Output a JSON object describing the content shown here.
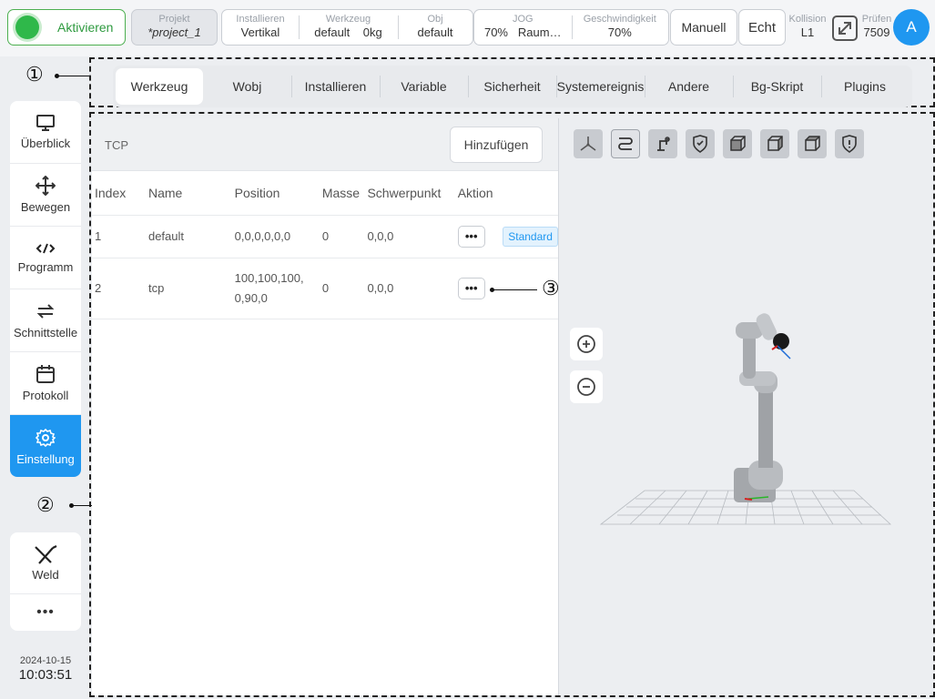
{
  "topbar": {
    "activate_label": "Aktivieren",
    "project": {
      "caption": "Projekt",
      "value": "*project_1"
    },
    "install": {
      "caption": "Installieren",
      "value": "Vertikal"
    },
    "tool": {
      "caption": "Werkzeug",
      "value": "default",
      "weight": "0kg"
    },
    "obj": {
      "caption": "Obj",
      "value": "default"
    },
    "jog": {
      "caption": "JOG",
      "value": "70%",
      "mode": "Raum…"
    },
    "speed": {
      "caption": "Geschwindigkeit",
      "value": "70%"
    },
    "manual_label": "Manuell",
    "real_label": "Echt",
    "collision": {
      "caption": "Kollision",
      "value": "L1"
    },
    "check": {
      "caption": "Prüfen",
      "value": "7509"
    },
    "avatar_letter": "A"
  },
  "sidebar": {
    "items": [
      {
        "label": "Überblick",
        "icon": "monitor-icon"
      },
      {
        "label": "Bewegen",
        "icon": "move-icon"
      },
      {
        "label": "Programm",
        "icon": "code-icon"
      },
      {
        "label": "Schnittstelle",
        "icon": "swap-icon"
      },
      {
        "label": "Protokoll",
        "icon": "calendar-icon"
      },
      {
        "label": "Einstellung",
        "icon": "gear-icon",
        "active": true
      }
    ],
    "weld_label": "Weld",
    "more_label": "•••"
  },
  "datetime": {
    "date": "2024-10-15",
    "time": "10:03:51"
  },
  "annotations": {
    "a1": "①",
    "a2": "②",
    "a3": "③"
  },
  "tabs": [
    {
      "label": "Werkzeug",
      "active": true
    },
    {
      "label": "Wobj"
    },
    {
      "label": "Installieren"
    },
    {
      "label": "Variable"
    },
    {
      "label": "Sicherheit"
    },
    {
      "label": "Systemereignis"
    },
    {
      "label": "Andere"
    },
    {
      "label": "Bg-Skript"
    },
    {
      "label": "Plugins"
    }
  ],
  "tcp_panel": {
    "title": "TCP",
    "add_label": "Hinzufügen",
    "columns": [
      "Index",
      "Name",
      "Position",
      "Masse",
      "Schwerpunkt",
      "Aktion"
    ],
    "rows": [
      {
        "index": "1",
        "name": "default",
        "position": "0,0,0,0,0,0",
        "mass": "0",
        "cog": "0,0,0",
        "badge": "Standard"
      },
      {
        "index": "2",
        "name": "tcp",
        "position_line1": "100,100,100,",
        "position_line2": "0,90,0",
        "mass": "0",
        "cog": "0,0,0"
      }
    ],
    "action_label": "•••"
  },
  "view3d": {
    "toolbar_icons": [
      "axes-icon",
      "path-icon",
      "robot-arm-icon",
      "shield-check-icon",
      "cube-front-icon",
      "cube-side-icon",
      "cube-top-icon",
      "shield-alert-icon"
    ],
    "zoom_in_icon": "zoom-in-icon",
    "zoom_out_icon": "zoom-out-icon"
  },
  "colors": {
    "accent": "#1f97f0",
    "active_green": "#2fb84a"
  }
}
